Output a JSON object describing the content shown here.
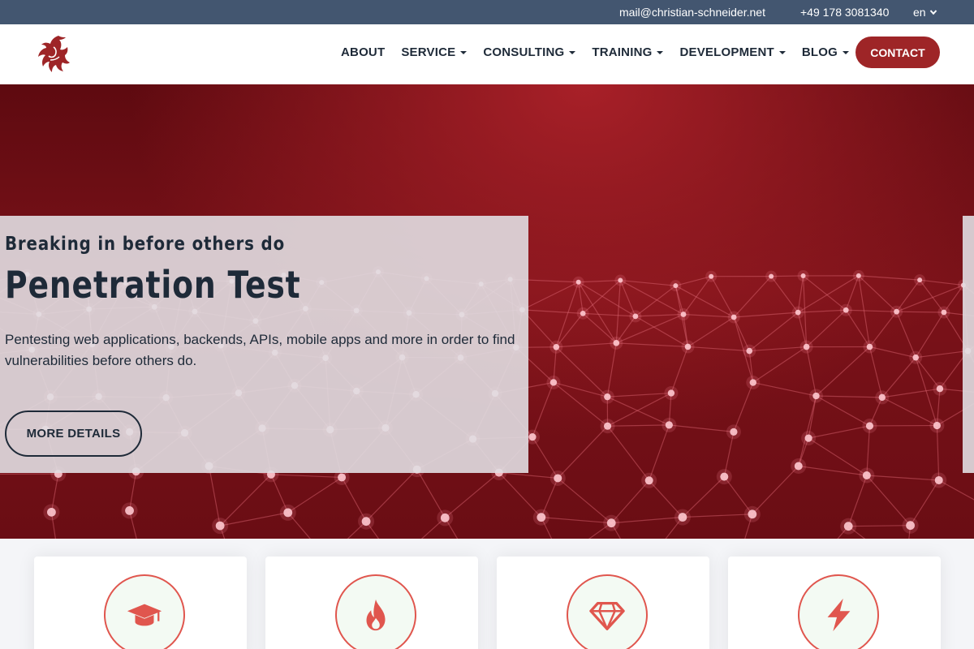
{
  "topbar": {
    "email": "mail@christian-schneider.net",
    "phone": "+49 178 3081340",
    "language": "en"
  },
  "header": {
    "nav": [
      {
        "label": "ABOUT",
        "has_dropdown": false
      },
      {
        "label": "SERVICE",
        "has_dropdown": true
      },
      {
        "label": "CONSULTING",
        "has_dropdown": true
      },
      {
        "label": "TRAINING",
        "has_dropdown": true
      },
      {
        "label": "DEVELOPMENT",
        "has_dropdown": true
      },
      {
        "label": "BLOG",
        "has_dropdown": true
      }
    ],
    "contact_label": "CONTACT"
  },
  "hero": {
    "eyebrow": "Breaking in before others do",
    "title": "Penetration Test",
    "text": "Pentesting web applications, backends, APIs, mobile apps and more in order to find vulnerabilities before others do.",
    "button_label": "MORE DETAILS"
  },
  "cards": [
    {
      "icon": "graduation-cap-icon"
    },
    {
      "icon": "fire-icon"
    },
    {
      "icon": "gem-icon"
    },
    {
      "icon": "bolt-icon"
    }
  ],
  "colors": {
    "topbar_bg": "#435670",
    "brand_red": "#9e2527",
    "text_dark": "#1e2a38",
    "icon_red": "#e0564e"
  }
}
